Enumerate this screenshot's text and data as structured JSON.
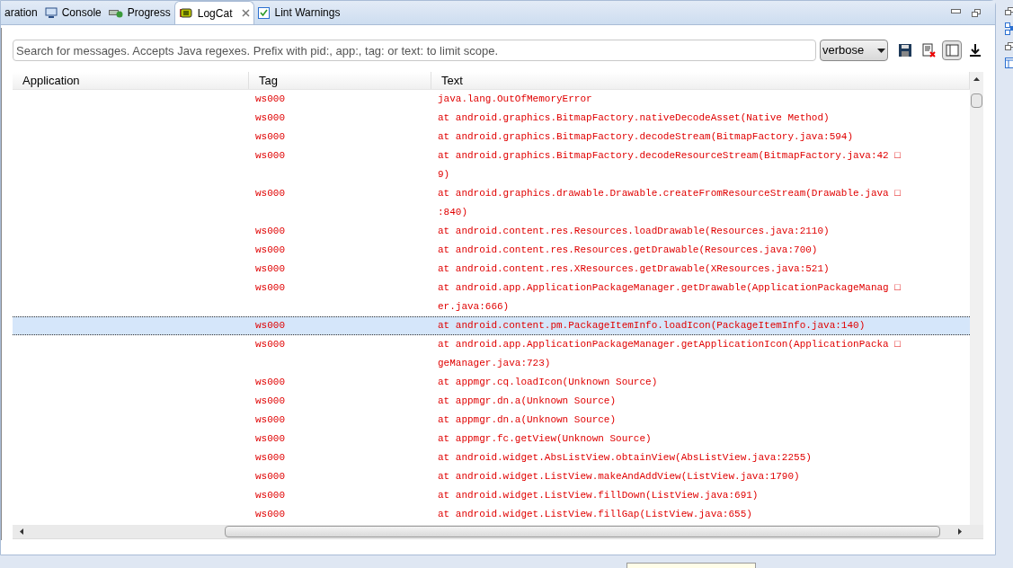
{
  "tabs": [
    {
      "label": "aration",
      "kind": "plain",
      "selected": false,
      "closable": false
    },
    {
      "label": "Console",
      "kind": "monitor",
      "selected": false,
      "closable": false
    },
    {
      "label": "Progress",
      "kind": "progress",
      "selected": false,
      "closable": false
    },
    {
      "label": "LogCat",
      "kind": "logcat",
      "selected": true,
      "closable": true
    },
    {
      "label": "Lint Warnings",
      "kind": "check",
      "selected": false,
      "closable": false
    }
  ],
  "search": {
    "placeholder": "Search for messages. Accepts Java regexes. Prefix with pid:, app:, tag: or text: to limit scope."
  },
  "level_select": {
    "value": "verbose"
  },
  "toolbar": [
    {
      "kind": "save",
      "on": false
    },
    {
      "kind": "clear",
      "on": false
    },
    {
      "kind": "panel",
      "on": true
    },
    {
      "kind": "scroll",
      "on": false
    }
  ],
  "table": {
    "columns": [
      "Application",
      "Tag",
      "Text"
    ],
    "rows": [
      {
        "tag": "ws000",
        "lines": [
          "java.lang.OutOfMemoryError"
        ],
        "selected": false
      },
      {
        "tag": "ws000",
        "lines": [
          "at android.graphics.BitmapFactory.nativeDecodeAsset(Native Method)"
        ],
        "selected": false
      },
      {
        "tag": "ws000",
        "lines": [
          "at android.graphics.BitmapFactory.decodeStream(BitmapFactory.java:594)"
        ],
        "selected": false
      },
      {
        "tag": "ws000",
        "lines": [
          "at android.graphics.BitmapFactory.decodeResourceStream(BitmapFactory.java:42 □",
          "9)"
        ],
        "selected": false
      },
      {
        "tag": "ws000",
        "lines": [
          "at android.graphics.drawable.Drawable.createFromResourceStream(Drawable.java □",
          ":840)"
        ],
        "selected": false
      },
      {
        "tag": "ws000",
        "lines": [
          "at android.content.res.Resources.loadDrawable(Resources.java:2110)"
        ],
        "selected": false
      },
      {
        "tag": "ws000",
        "lines": [
          "at android.content.res.Resources.getDrawable(Resources.java:700)"
        ],
        "selected": false
      },
      {
        "tag": "ws000",
        "lines": [
          "at android.content.res.XResources.getDrawable(XResources.java:521)"
        ],
        "selected": false
      },
      {
        "tag": "ws000",
        "lines": [
          "at android.app.ApplicationPackageManager.getDrawable(ApplicationPackageManag □",
          "er.java:666)"
        ],
        "selected": false
      },
      {
        "tag": "ws000",
        "lines": [
          "at android.content.pm.PackageItemInfo.loadIcon(PackageItemInfo.java:140)"
        ],
        "selected": true
      },
      {
        "tag": "ws000",
        "lines": [
          "at android.app.ApplicationPackageManager.getApplicationIcon(ApplicationPacka □",
          "geManager.java:723)"
        ],
        "selected": false
      },
      {
        "tag": "ws000",
        "lines": [
          "at appmgr.cq.loadIcon(Unknown Source)"
        ],
        "selected": false
      },
      {
        "tag": "ws000",
        "lines": [
          "at appmgr.dn.a(Unknown Source)"
        ],
        "selected": false
      },
      {
        "tag": "ws000",
        "lines": [
          "at appmgr.dn.a(Unknown Source)"
        ],
        "selected": false
      },
      {
        "tag": "ws000",
        "lines": [
          "at appmgr.fc.getView(Unknown Source)"
        ],
        "selected": false
      },
      {
        "tag": "ws000",
        "lines": [
          "at android.widget.AbsListView.obtainView(AbsListView.java:2255)"
        ],
        "selected": false
      },
      {
        "tag": "ws000",
        "lines": [
          "at android.widget.ListView.makeAndAddView(ListView.java:1790)"
        ],
        "selected": false
      },
      {
        "tag": "ws000",
        "lines": [
          "at android.widget.ListView.fillDown(ListView.java:691)"
        ],
        "selected": false
      },
      {
        "tag": "ws000",
        "lines": [
          "at android.widget.ListView.fillGap(ListView.java:655)"
        ],
        "selected": false
      }
    ]
  }
}
